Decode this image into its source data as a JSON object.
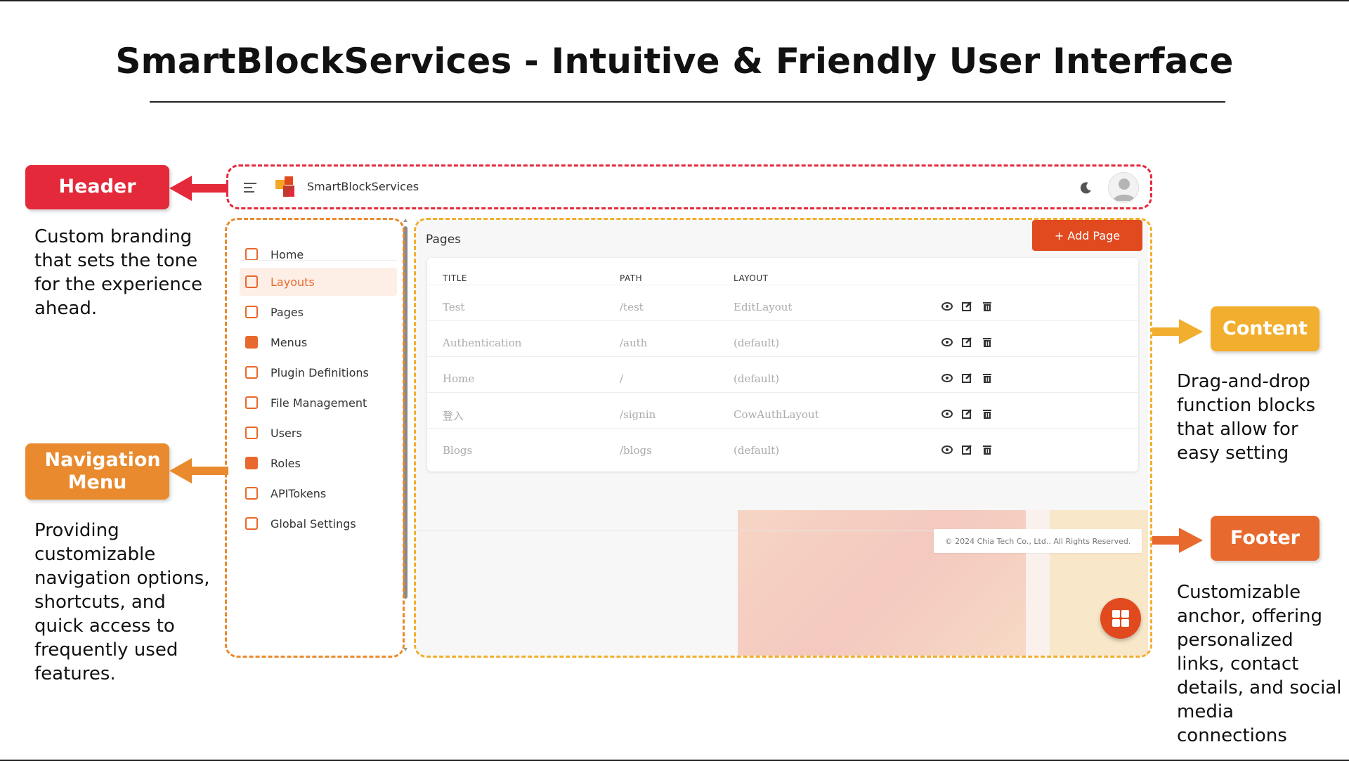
{
  "slide_title": "SmartBlockServices - Intuitive & Friendly User Interface",
  "callouts": {
    "header": {
      "label": "Header",
      "description": "Custom branding that sets the tone for the experience ahead."
    },
    "navigation": {
      "label": "Navigation Menu",
      "description": "Providing customizable navigation options, shortcuts, and quick access to frequently used features."
    },
    "content": {
      "label": "Content",
      "description": "Drag-and-drop function blocks that allow for easy setting"
    },
    "footer": {
      "label": "Footer",
      "description": "Customizable anchor, offering personalized links, contact details, and social media connections"
    }
  },
  "app": {
    "brand_name": "SmartBlockServices",
    "icons": {
      "menu": "hamburger-icon",
      "theme": "moon-icon",
      "user": "avatar-icon",
      "fab": "grid-icon"
    },
    "sidebar": {
      "items": [
        {
          "label": "Home",
          "icon": "home-icon"
        },
        {
          "label": "Layouts",
          "icon": "layout-icon",
          "active": true
        },
        {
          "label": "Pages",
          "icon": "page-icon"
        },
        {
          "label": "Menus",
          "icon": "menu-list-icon"
        },
        {
          "label": "Plugin Definitions",
          "icon": "plugin-icon"
        },
        {
          "label": "File Management",
          "icon": "file-icon"
        },
        {
          "label": "Users",
          "icon": "user-icon"
        },
        {
          "label": "Roles",
          "icon": "roles-icon"
        },
        {
          "label": "APITokens",
          "icon": "token-icon"
        },
        {
          "label": "Global Settings",
          "icon": "settings-icon"
        }
      ]
    },
    "content": {
      "title": "Pages",
      "add_button": "+ Add Page",
      "columns": [
        "TITLE",
        "PATH",
        "LAYOUT"
      ],
      "rows": [
        {
          "title": "Test",
          "path": "/test",
          "layout": "EditLayout"
        },
        {
          "title": "Authentication",
          "path": "/auth",
          "layout": "(default)"
        },
        {
          "title": "Home",
          "path": "/",
          "layout": "(default)"
        },
        {
          "title": "登入",
          "path": "/signin",
          "layout": "CowAuthLayout"
        },
        {
          "title": "Blogs",
          "path": "/blogs",
          "layout": "(default)"
        }
      ],
      "row_actions": [
        "view-icon",
        "edit-icon",
        "delete-icon"
      ]
    },
    "footer": "© 2024 Chia Tech Co., Ltd.. All Rights Reserved."
  },
  "colors": {
    "header_red": "#e4293a",
    "nav_orange": "#e88a2d",
    "content_yellow": "#f2ae2e",
    "footer_orange": "#e8692d",
    "brand_accent": "#e14a1f"
  }
}
